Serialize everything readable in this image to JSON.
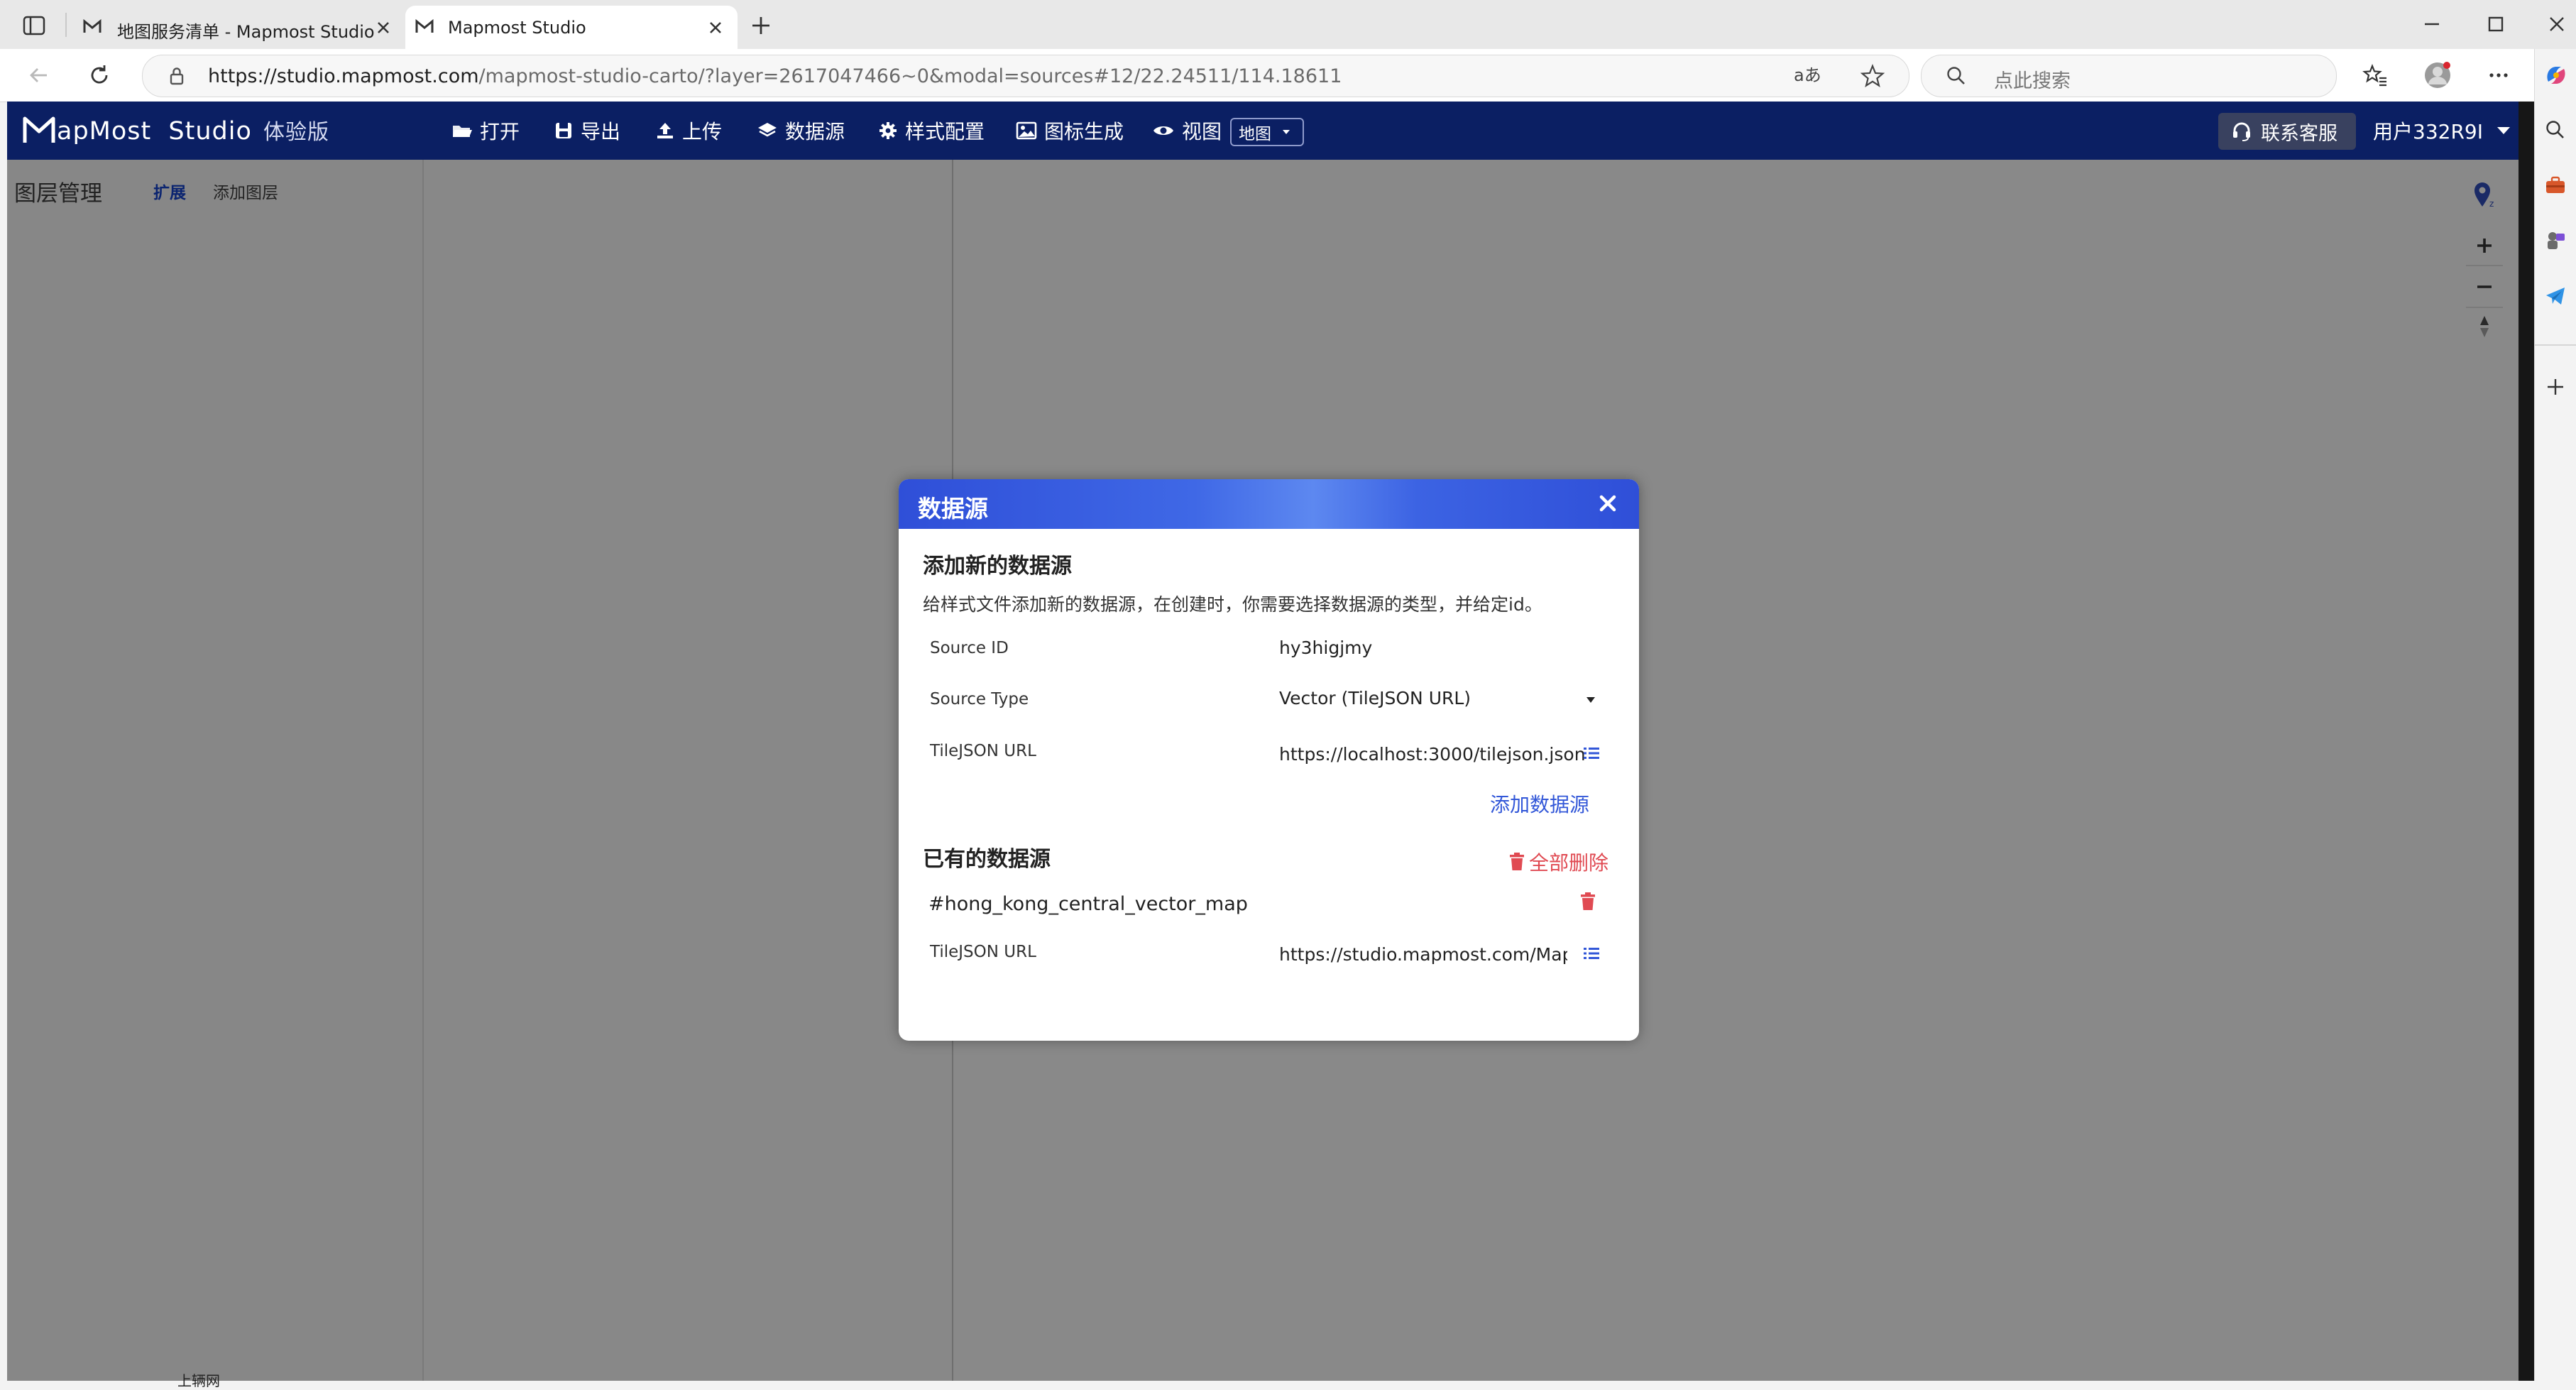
{
  "browser": {
    "tabs": [
      {
        "title": "地图服务清单 - Mapmost Studio",
        "active": false
      },
      {
        "title": "Mapmost Studio",
        "active": true
      }
    ],
    "url_host": "https://studio.mapmost.com",
    "url_path": "/mapmost-studio-carto/?layer=2617047466~0&modal=sources#12/22.24511/114.18611",
    "search_placeholder": "点此搜索"
  },
  "app": {
    "logo": "apMost",
    "logo_suffix": "Studio",
    "edition": "体验版",
    "menu": [
      {
        "label": "打开",
        "icon": "folder-open-icon"
      },
      {
        "label": "导出",
        "icon": "save-icon"
      },
      {
        "label": "上传",
        "icon": "upload-icon"
      },
      {
        "label": "数据源",
        "icon": "layers-icon"
      },
      {
        "label": "样式配置",
        "icon": "gear-icon"
      },
      {
        "label": "图标生成",
        "icon": "image-icon"
      },
      {
        "label": "视图",
        "icon": "eye-icon"
      }
    ],
    "view_select": "地图",
    "support": "联系客服",
    "user": "用户332R9I"
  },
  "layers_panel": {
    "title": "图层管理",
    "expand": "扩展",
    "add_layer": "添加图层",
    "bottom_fragment": "上辆网"
  },
  "modal": {
    "title": "数据源",
    "new_section": {
      "title": "添加新的数据源",
      "description": "给样式文件添加新的数据源，在创建时，你需要选择数据源的类型，并给定id。",
      "source_id_label": "Source ID",
      "source_id_value": "hy3higjmy",
      "source_type_label": "Source Type",
      "source_type_value": "Vector (TileJSON URL)",
      "tilejson_label": "TileJSON URL",
      "tilejson_value": "https://localhost:3000/tilejson.json",
      "add_button": "添加数据源"
    },
    "existing_section": {
      "title": "已有的数据源",
      "delete_all": "全部删除",
      "sources": [
        {
          "id": "#hong_kong_central_vector_map",
          "url_label": "TileJSON URL",
          "url": "https://studio.mapmost.com/Mapmost"
        }
      ]
    }
  },
  "colors": {
    "app_bar": "#0b1f63",
    "modal_header": "#3f68e6",
    "link_blue": "#3257d8",
    "danger_red": "#e04a52"
  }
}
